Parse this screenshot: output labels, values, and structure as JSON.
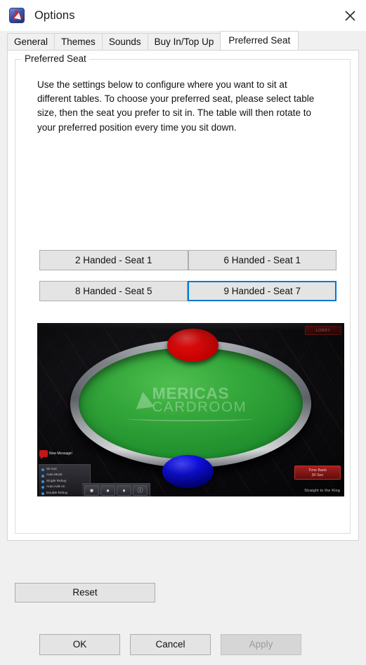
{
  "window": {
    "title": "Options",
    "icon": "acr-star-icon",
    "close_label": "close-icon"
  },
  "tabs": [
    {
      "label": "General",
      "active": false
    },
    {
      "label": "Themes",
      "active": false
    },
    {
      "label": "Sounds",
      "active": false
    },
    {
      "label": "Buy In/Top Up",
      "active": false
    },
    {
      "label": "Preferred Seat",
      "active": true
    }
  ],
  "group": {
    "legend": "Preferred Seat",
    "description": "Use the settings below to configure where you want to sit at different tables. To choose your preferred seat, please select table size, then the seat you prefer to sit in. The table will then rotate to your preferred position every time you sit down."
  },
  "seat_buttons": [
    {
      "label": "2 Handed - Seat 1",
      "selected": false
    },
    {
      "label": "6 Handed - Seat 1",
      "selected": false
    },
    {
      "label": "8 Handed - Seat 5",
      "selected": false
    },
    {
      "label": "9 Handed - Seat 7",
      "selected": true
    }
  ],
  "preview": {
    "logo_line1": "MERICAS",
    "logo_line2": "CARDROOM",
    "lobby_label": "LOBBY",
    "time_bank_label": "Time Bank",
    "time_bank_value": "30 Sec",
    "tagline": "Straight to the King",
    "new_message": "New Message!",
    "options": [
      "Sit Out",
      "Auto Muck",
      "Single Rebuy",
      "Auto Add-on",
      "Double Rebuy"
    ],
    "toolbar_icons": [
      "note-icon",
      "chat-icon",
      "cards-icon",
      "info-icon"
    ],
    "seat_markers": [
      {
        "name": "occupied-seat-red",
        "color": "#f00b0b",
        "position": "top"
      },
      {
        "name": "preferred-seat-blue",
        "color": "#1010e8",
        "position": "bottom"
      }
    ],
    "felt_color": "#33a63a",
    "rail_color": "#8e9298"
  },
  "reset": {
    "label": "Reset"
  },
  "footer": {
    "ok_label": "OK",
    "cancel_label": "Cancel",
    "apply_label": "Apply",
    "apply_disabled": true
  },
  "colors": {
    "accent": "#0078d7",
    "button_face": "#e4e4e4",
    "panel": "#f0f0f0",
    "content": "#ffffff"
  }
}
